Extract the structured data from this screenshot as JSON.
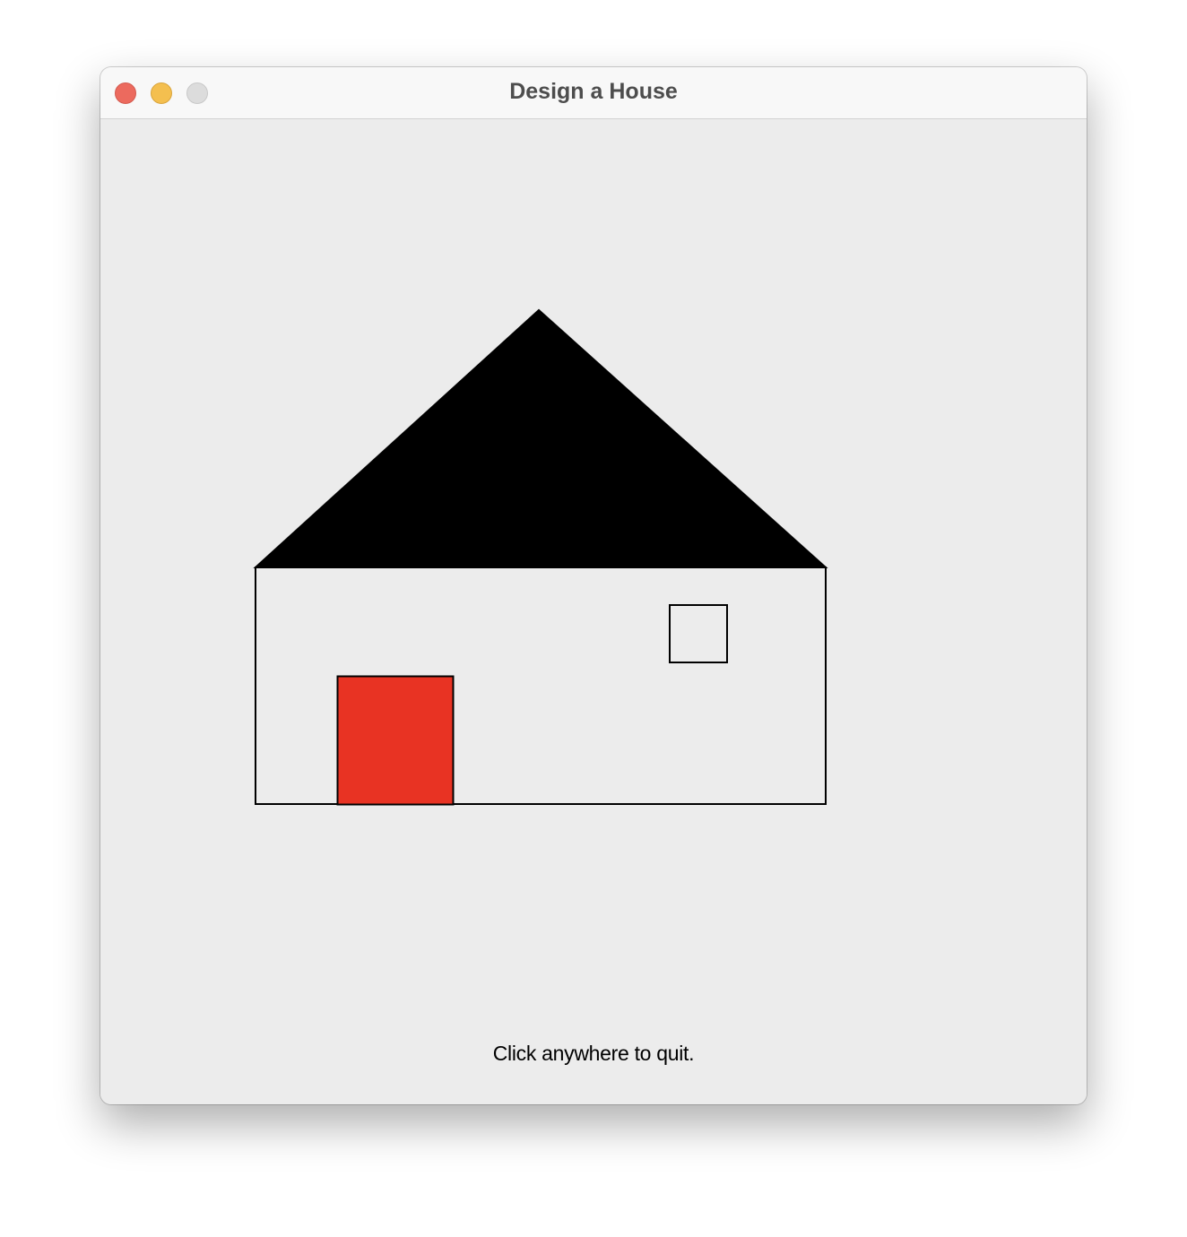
{
  "window": {
    "title": "Design a House",
    "controls": {
      "close": "close-button",
      "minimize": "minimize-button",
      "zoom": "zoom-button"
    }
  },
  "canvas": {
    "background_color": "#ececec",
    "message": "Click anywhere to quit.",
    "shapes": {
      "roof": {
        "fill": "#000000",
        "stroke": "#000000"
      },
      "house_body": {
        "fill": "none",
        "stroke": "#000000"
      },
      "door": {
        "fill": "#e83323",
        "stroke": "#000000"
      },
      "window": {
        "fill": "none",
        "stroke": "#000000"
      }
    }
  },
  "colors": {
    "traffic_close": "#ec6a5e",
    "traffic_minimize": "#f4bf4f",
    "traffic_zoom": "#dcdcdc",
    "title_text": "#4d4d4d"
  }
}
